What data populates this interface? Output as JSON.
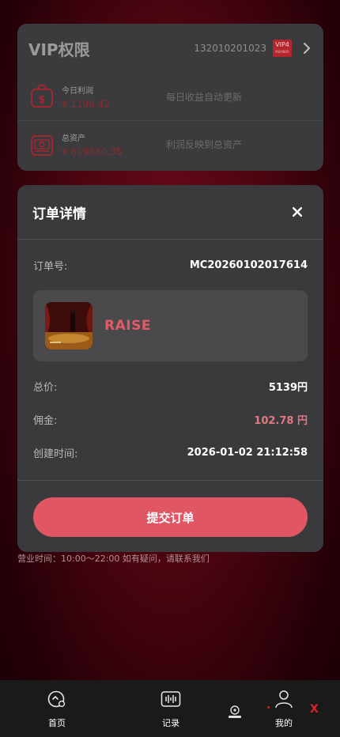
{
  "vip": {
    "title": "VIP权限",
    "account": "132010201023",
    "badge_main": "VIP4",
    "badge_sub": "MEMBER",
    "today_profit_label": "今日利润",
    "today_profit_value": "¥ 1196.42",
    "today_profit_note": "每日收益自动更新",
    "total_assets_label": "总资产",
    "total_assets_value": "¥ 619530.35",
    "total_assets_note": "利润反映到总资产"
  },
  "modal": {
    "title": "订单详情",
    "order_no_label": "订单号:",
    "order_no_value": "MC20260102017614",
    "product_name": "RAISE",
    "price_label": "总价:",
    "price_value": "5139円",
    "commission_label": "佣金:",
    "commission_value": "102.78 円",
    "created_label": "创建时间:",
    "created_value": "2026-01-02 21:12:58",
    "submit_label": "提交订单"
  },
  "hours_text": "营业时间：10:00～22:00 如有疑问，请联系我们",
  "nav": {
    "home": "首页",
    "records": "记录",
    "mine": "我的",
    "close": "X"
  },
  "colors": {
    "accent": "#e05664",
    "commission": "#e07a82",
    "product_name": "#e35a68"
  }
}
